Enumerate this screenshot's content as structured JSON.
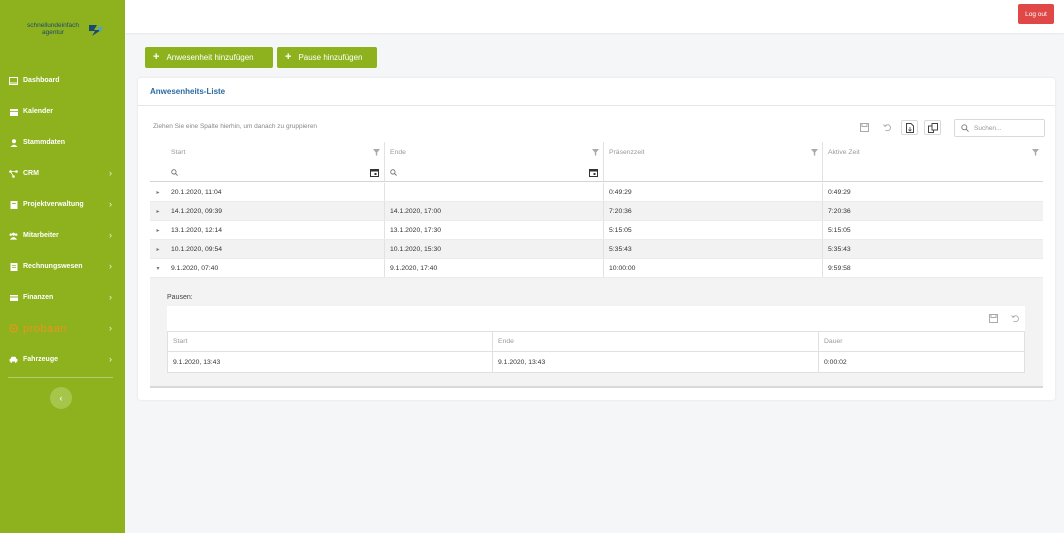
{
  "logo": {
    "line1": "schnellundeinfach",
    "line2": "agentur"
  },
  "sidebar": {
    "items": [
      {
        "label": "Dashboard",
        "icon": "dashboard-icon",
        "chevron": false
      },
      {
        "label": "Kalender",
        "icon": "calendar-icon",
        "chevron": false
      },
      {
        "label": "Stammdaten",
        "icon": "user-icon",
        "chevron": false
      },
      {
        "label": "CRM",
        "icon": "network-icon",
        "chevron": true
      },
      {
        "label": "Projektverwaltung",
        "icon": "book-icon",
        "chevron": true
      },
      {
        "label": "Mitarbeiter",
        "icon": "users-icon",
        "chevron": true
      },
      {
        "label": "Rechnungswesen",
        "icon": "invoice-icon",
        "chevron": true
      },
      {
        "label": "Finanzen",
        "icon": "finance-icon",
        "chevron": true
      },
      {
        "label": "probaan",
        "icon": "probaan-logo-icon",
        "chevron": true
      },
      {
        "label": "Fahrzeuge",
        "icon": "car-icon",
        "chevron": true
      }
    ],
    "chevron": "›",
    "collapse": "‹"
  },
  "topbar": {
    "logout_label": "Log out"
  },
  "actions": {
    "add_attendance": "Anwesenheit hinzufügen",
    "add_break": "Pause hinzufügen",
    "plus": "+"
  },
  "panel": {
    "title": "Anwesenheits-Liste",
    "group_hint": "Ziehen Sie eine Spalte hierhin, um danach zu gruppieren",
    "search_placeholder": "Suchen..."
  },
  "grid": {
    "columns": [
      "Start",
      "Ende",
      "Präsenzzeit",
      "Aktive Zeit"
    ],
    "rows": [
      {
        "start": "20.1.2020, 11:04",
        "end": "",
        "presence": "0:49:29",
        "active": "0:49:29",
        "expanded": false
      },
      {
        "start": "14.1.2020, 09:39",
        "end": "14.1.2020, 17:00",
        "presence": "7:20:36",
        "active": "7:20:36",
        "expanded": false
      },
      {
        "start": "13.1.2020, 12:14",
        "end": "13.1.2020, 17:30",
        "presence": "5:15:05",
        "active": "5:15:05",
        "expanded": false
      },
      {
        "start": "10.1.2020, 09:54",
        "end": "10.1.2020, 15:30",
        "presence": "5:35:43",
        "active": "5:35:43",
        "expanded": false
      },
      {
        "start": "9.1.2020, 07:40",
        "end": "9.1.2020, 17:40",
        "presence": "10:00:00",
        "active": "9:59:58",
        "expanded": true
      }
    ]
  },
  "detail": {
    "label": "Pausen:",
    "columns": [
      "Start",
      "Ende",
      "Dauer"
    ],
    "rows": [
      {
        "start": "9.1.2020, 13:43",
        "end": "9.1.2020, 13:43",
        "duration": "0:00:02"
      }
    ]
  },
  "colors": {
    "sidebar": "#8db21d",
    "title": "#2c6aa0",
    "logout": "#e04848",
    "brand_orange": "#e8961e"
  }
}
